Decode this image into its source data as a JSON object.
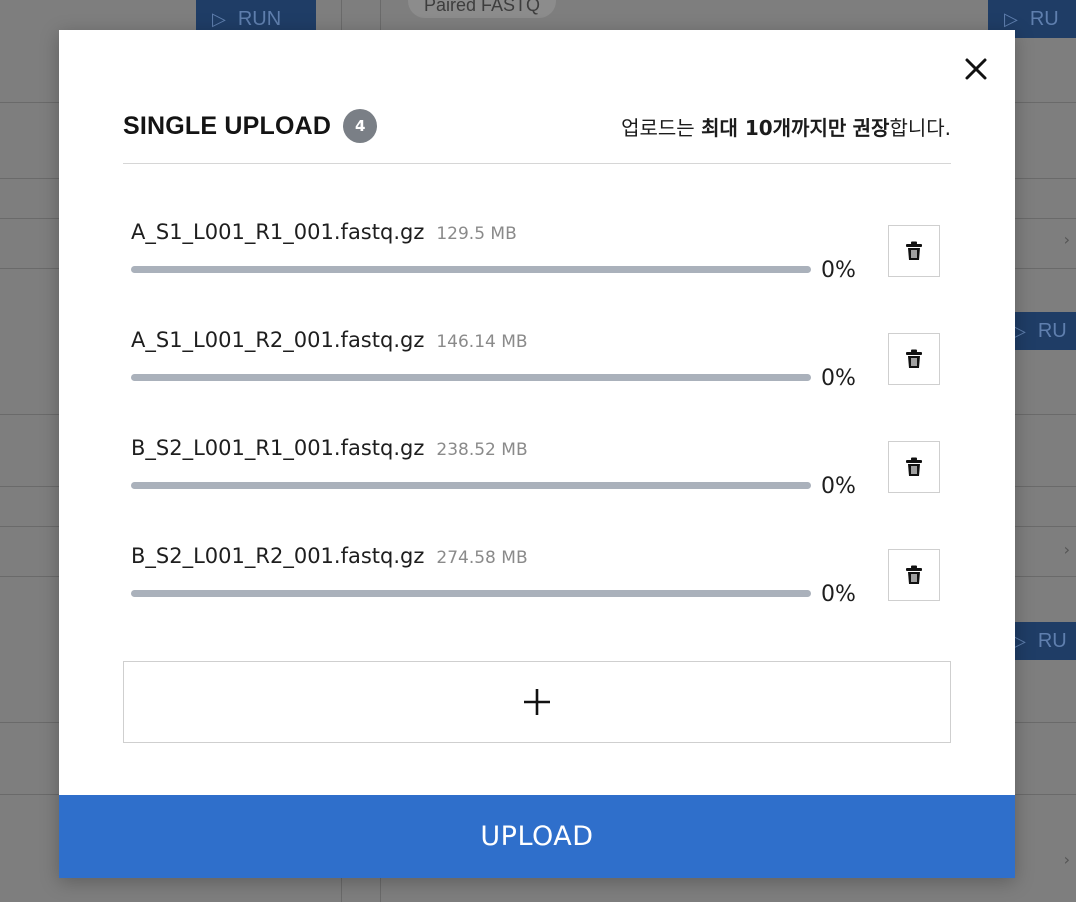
{
  "background": {
    "run_buttons": [
      "RUN",
      "RU",
      "RU",
      "RU"
    ],
    "chip_label": "Paired FASTQ"
  },
  "modal": {
    "title": "SINGLE UPLOAD",
    "file_count": "4",
    "notice": {
      "prefix": "업로드는 ",
      "bold1": "최대 10개까지만",
      "middle": " ",
      "bold2": "권장",
      "suffix": "합니다."
    },
    "files": [
      {
        "name": "A_S1_L001_R1_001.fastq.gz",
        "size": "129.5 MB",
        "progress_label": "0%",
        "progress": 0
      },
      {
        "name": "A_S1_L001_R2_001.fastq.gz",
        "size": "146.14 MB",
        "progress_label": "0%",
        "progress": 0
      },
      {
        "name": "B_S2_L001_R1_001.fastq.gz",
        "size": "238.52 MB",
        "progress_label": "0%",
        "progress": 0
      },
      {
        "name": "B_S2_L001_R2_001.fastq.gz",
        "size": "274.58 MB",
        "progress_label": "0%",
        "progress": 0
      }
    ],
    "add_label": "+",
    "upload_label": "UPLOAD",
    "icons": {
      "close": "close-icon",
      "delete": "trash-icon",
      "add": "plus-icon"
    },
    "colors": {
      "accent": "#2f6fcb",
      "track": "#aab1bb",
      "badge": "#7a7f86"
    }
  }
}
